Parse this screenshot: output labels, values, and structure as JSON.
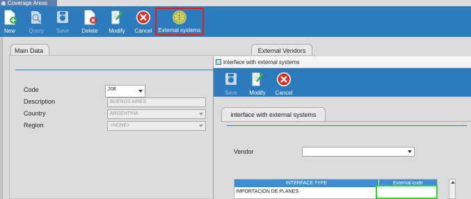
{
  "window": {
    "title": "Coverage Areas"
  },
  "toolbar": {
    "new": "New",
    "query": "Query",
    "save": "Save",
    "delete": "Delete",
    "modify": "Modify",
    "cancel": "Cancel",
    "external": "External systems"
  },
  "tabs": {
    "main": "Main Data",
    "vendors": "External Vendors"
  },
  "form": {
    "code_label": "Code",
    "code_value": "208",
    "description_label": "Description",
    "description_value": "BUENOS AIRES",
    "country_label": "Country",
    "country_value": "ARGENTINA",
    "region_label": "Region",
    "region_value": "<NONE>"
  },
  "ext": {
    "title": "interface with external systems",
    "save": "Save",
    "modify": "Modify",
    "cancel": "Cancel",
    "tab": "interface with external systems",
    "vendor_label": "Vendor",
    "vendor_value": "",
    "col_interface": "INTERFACE TYPE",
    "col_external": "External code",
    "rows": [
      {
        "interface": "IMPORTACION DE PLANES",
        "external": ""
      }
    ]
  },
  "colors": {
    "toolbar": "#2b7bbd",
    "highlight_red": "#e01e1e",
    "highlight_green": "#2ad62a",
    "table_header": "#3a8fd6"
  }
}
